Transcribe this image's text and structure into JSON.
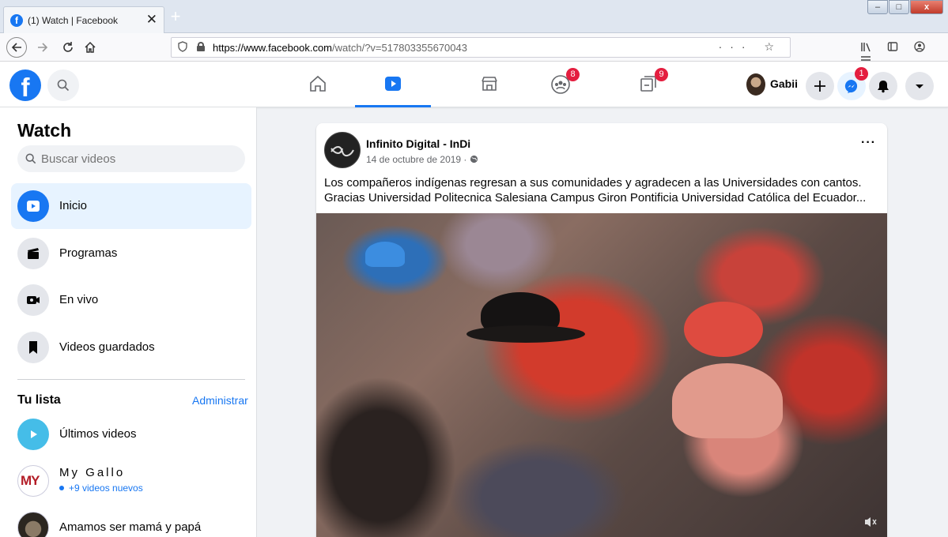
{
  "browser": {
    "tab_title": "(1) Watch | Facebook",
    "tab_close": "✕",
    "new_tab": "+",
    "url_domain": "https://www.facebook.com",
    "url_path": "/watch/?v=517803355670043",
    "url_actions": "··· ☆",
    "win_min": "–",
    "win_max": "□",
    "win_close": "x"
  },
  "header": {
    "profile_name": "Gabii",
    "groups_badge": "8",
    "gaming_badge": "9",
    "messenger_badge": "1"
  },
  "sidebar": {
    "title": "Watch",
    "search_placeholder": "Buscar videos",
    "items": [
      {
        "label": "Inicio"
      },
      {
        "label": "Programas"
      },
      {
        "label": "En vivo"
      },
      {
        "label": "Videos guardados"
      }
    ],
    "list_title": "Tu lista",
    "list_admin": "Administrar",
    "latest_label": "Últimos videos",
    "page_logo_text": "MY",
    "page_name": "My Gallo",
    "page_sub": "+9 videos nuevos",
    "page2_name": "Amamos ser mamá y papá"
  },
  "post": {
    "author": "Infinito Digital - InDi",
    "date": "14 de octubre de 2019 · ",
    "more": "···",
    "text_line1": "Los compañeros indígenas regresan a sus comunidades y agradecen a las Universidades con cantos.",
    "text_line2": "Gracias Universidad Politecnica Salesiana Campus Giron Pontificia Universidad Católica del Ecuador..."
  },
  "colors": {
    "brand": "#1877f2",
    "badge": "#e41e3f",
    "background": "#f0f2f5"
  }
}
